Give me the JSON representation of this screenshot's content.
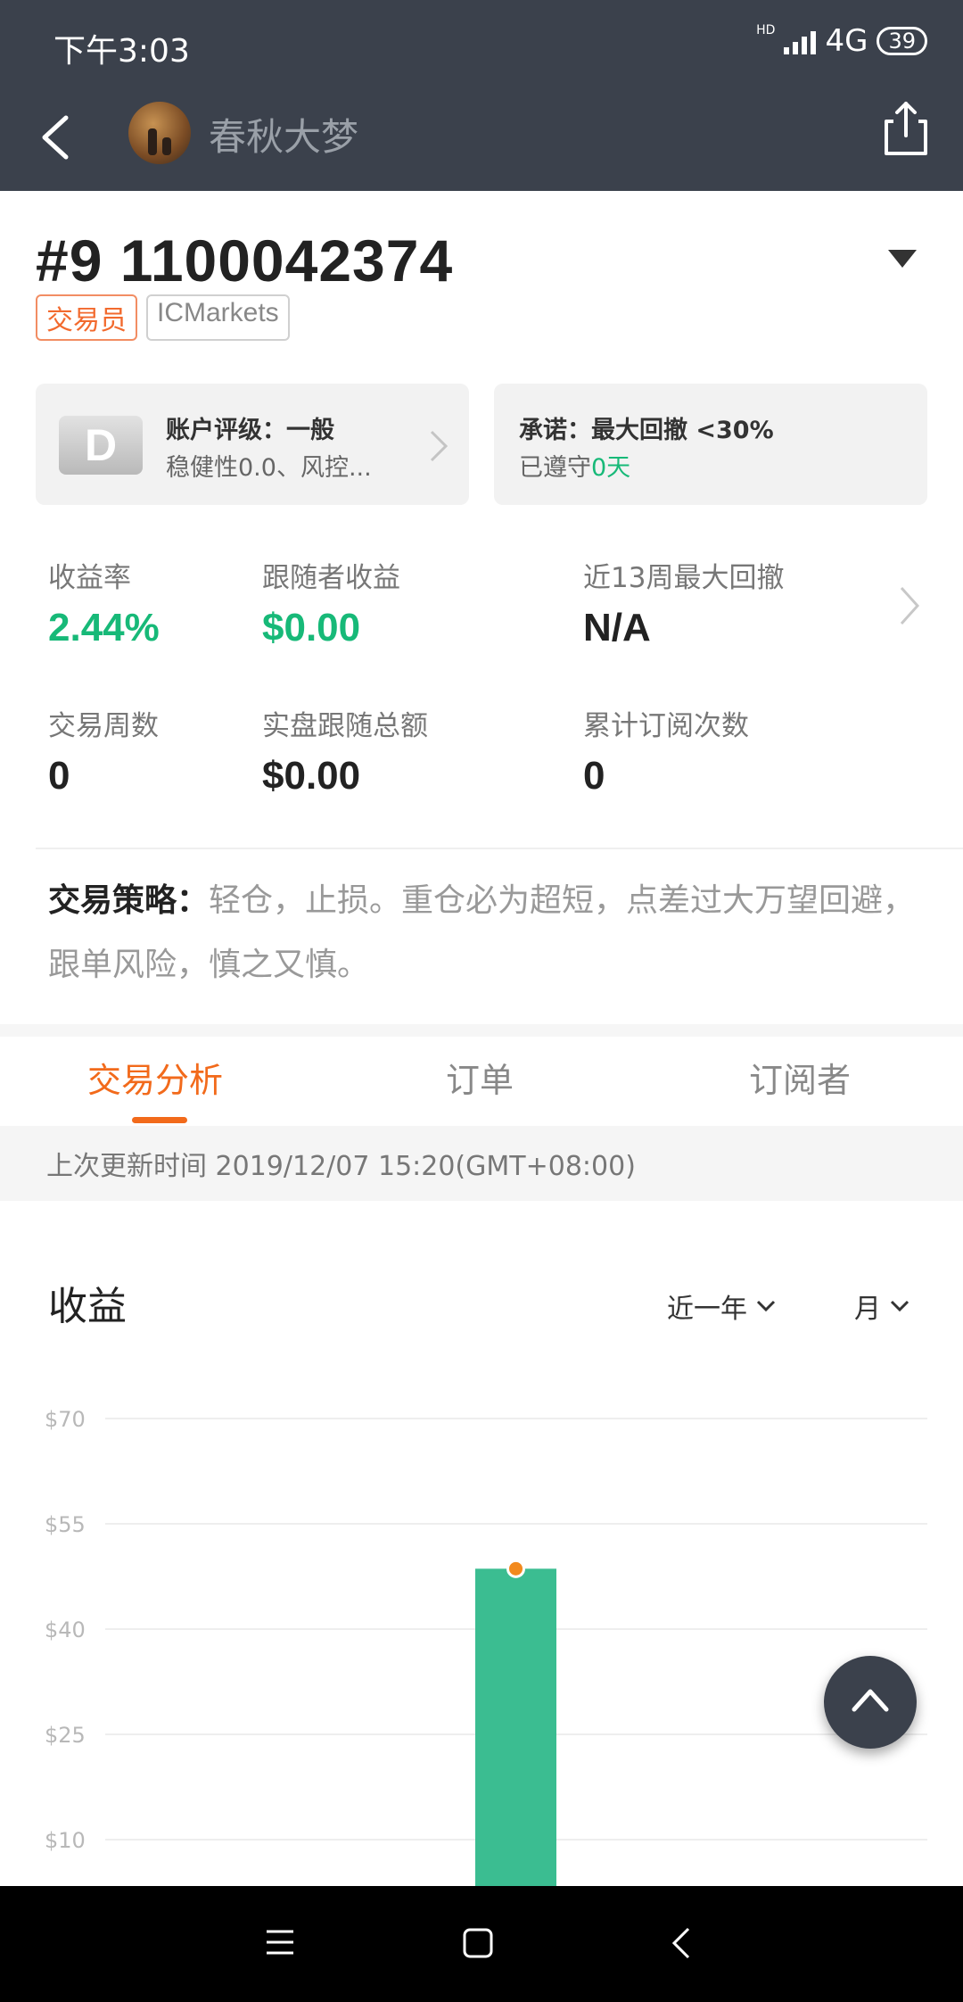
{
  "status_bar": {
    "time": "下午3:03",
    "network": "4G",
    "battery": "39"
  },
  "nav": {
    "username": "春秋大梦"
  },
  "account": {
    "number": "#9 1100042374",
    "tags": [
      "交易员",
      "ICMarkets"
    ]
  },
  "cards": {
    "rating_letter": "D",
    "rating_title": "账户评级：一般",
    "rating_sub": "稳健性0.0、风控...",
    "promise_title": "承诺：最大回撤 <30%",
    "promise_prefix": "已遵守",
    "promise_days": "0天"
  },
  "stats": [
    {
      "label": "收益率",
      "value": "2.44%"
    },
    {
      "label": "跟随者收益",
      "value": "$0.00"
    },
    {
      "label": "近13周最大回撤",
      "value": "N/A"
    },
    {
      "label": "交易周数",
      "value": "0"
    },
    {
      "label": "实盘跟随总额",
      "value": "$0.00"
    },
    {
      "label": "累计订阅次数",
      "value": "0"
    }
  ],
  "strategy": {
    "label": "交易策略：",
    "text": "轻仓，止损。重仓必为超短，点差过大万望回避，跟单风险，慎之又慎。"
  },
  "tabs": [
    "交易分析",
    "订单",
    "订阅者"
  ],
  "update_time": "上次更新时间 2019/12/07 15:20(GMT+08:00)",
  "section": {
    "title": "收益",
    "range": "近一年",
    "period": "月"
  },
  "colors": {
    "accent": "#f26a1b",
    "positive": "#17b978",
    "bar": "#3bbd91",
    "marker": "#f28a1e",
    "header": "#3b414c"
  },
  "chart_data": {
    "type": "bar",
    "ylim": [
      10,
      70
    ],
    "yticks": [
      "$70",
      "$55",
      "$40",
      "$25",
      "$10"
    ],
    "tick_values": [
      70,
      55,
      40,
      25,
      10
    ],
    "series": [
      {
        "values": [
          48.6
        ]
      }
    ]
  }
}
